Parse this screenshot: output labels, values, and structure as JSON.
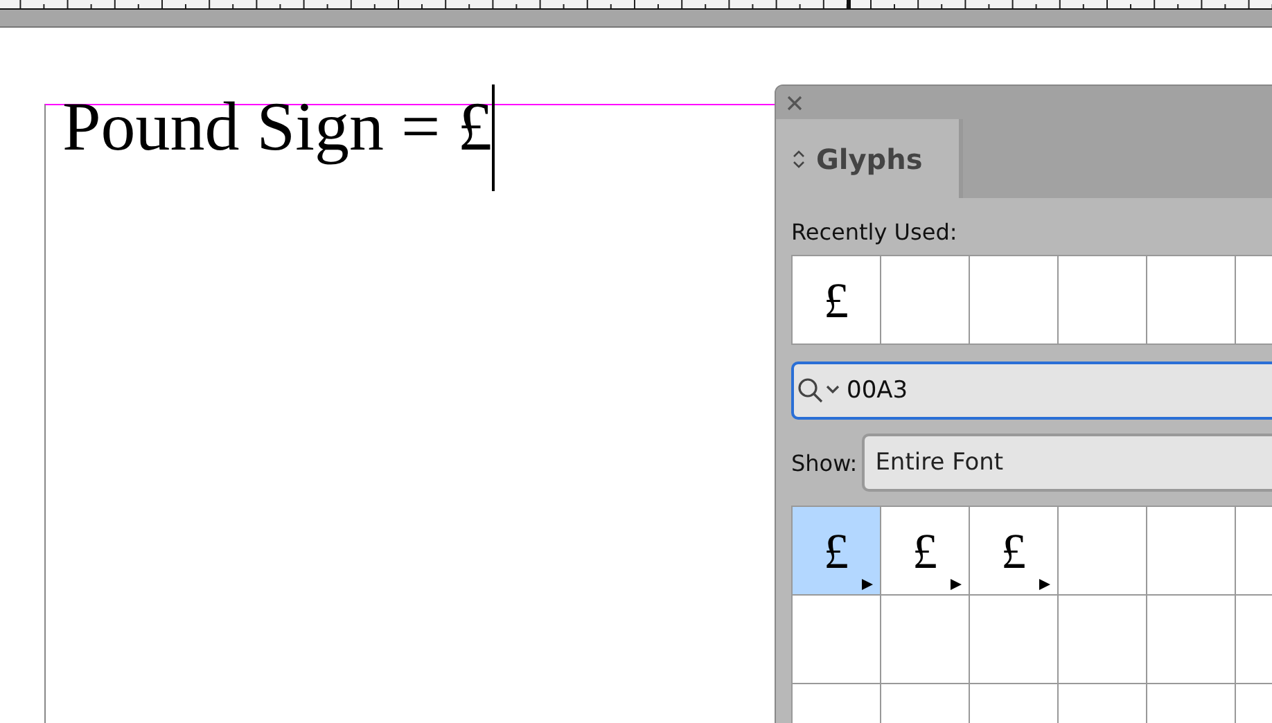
{
  "document": {
    "text": "Pound Sign = £"
  },
  "panel": {
    "tab": {
      "label": "Glyphs",
      "selected": true
    },
    "recently_used": {
      "label": "Recently Used:",
      "glyphs": [
        {
          "glyph": "£"
        }
      ]
    },
    "search": {
      "value": "00A3"
    },
    "show": {
      "label": "Show:",
      "value": "Entire Font"
    },
    "glyphs": [
      {
        "glyph": "£",
        "selected": true,
        "alternates": true
      },
      {
        "glyph": "£",
        "selected": false,
        "alternates": true
      },
      {
        "glyph": "£",
        "selected": false,
        "alternates": true
      }
    ]
  }
}
